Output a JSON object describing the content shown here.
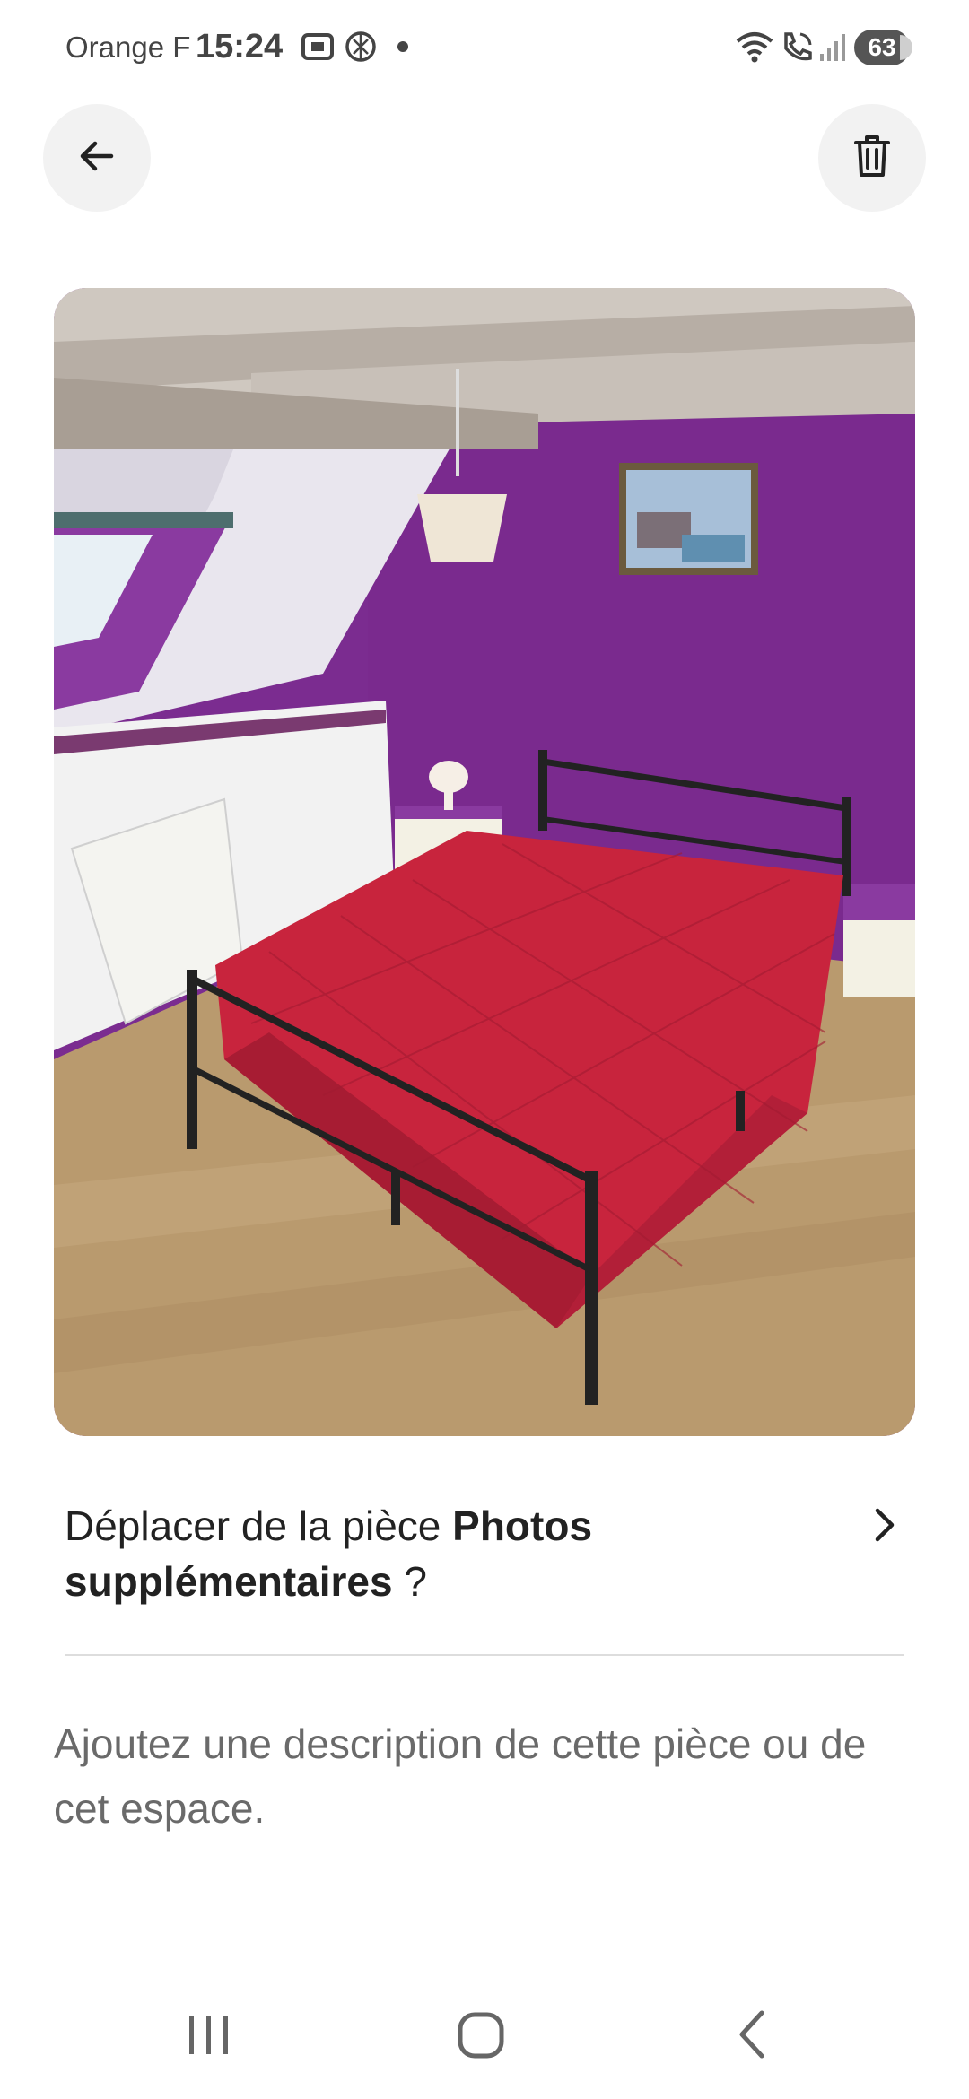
{
  "status_bar": {
    "carrier": "Orange F",
    "time": "15:24",
    "battery": "63",
    "icons": [
      "screenshot-icon",
      "openai-icon",
      "notification-dot-icon",
      "wifi-icon",
      "wifi-calling-icon",
      "signal-icon",
      "battery-icon"
    ]
  },
  "toolbar": {
    "back_icon": "arrow-left-icon",
    "delete_icon": "trash-icon"
  },
  "photo": {
    "subject": "room-photo"
  },
  "move": {
    "prefix": "Déplacer de la pièce ",
    "room": "Photos supplémentaires",
    "suffix": " ?"
  },
  "description": {
    "placeholder": "Ajoutez une description de cette pièce ou de cet espace."
  },
  "navigation": {
    "icons": [
      "recent-apps-icon",
      "home-icon",
      "back-icon"
    ]
  },
  "colors": {
    "wall_purple": "#7a2a8e",
    "bedspread_red": "#c8243d",
    "floor_wood": "#b99a6e",
    "text_dark": "#222222",
    "text_muted": "#6a6a6a"
  }
}
